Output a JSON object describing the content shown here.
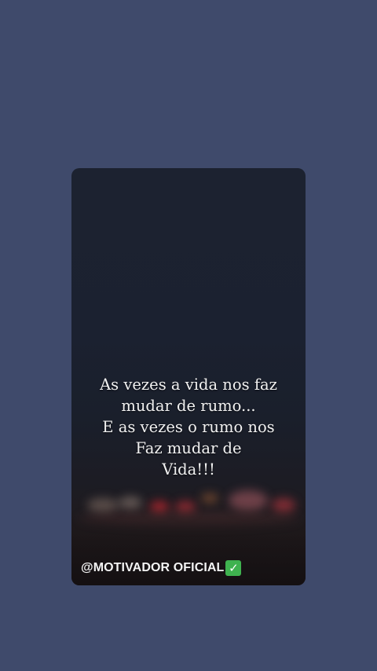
{
  "post": {
    "quote_lines": [
      "As vezes a vida nos faz",
      "mudar de rumo...",
      "E as vezes o rumo nos",
      "Faz mudar de",
      "Vida!!!"
    ],
    "handle": "@MOTIVADOR OFICIAL",
    "verified_icon": "check-mark-button-icon",
    "colors": {
      "background": "#3f4a6b",
      "card_top": "#1c2230",
      "verified": "#3fb24f"
    }
  }
}
